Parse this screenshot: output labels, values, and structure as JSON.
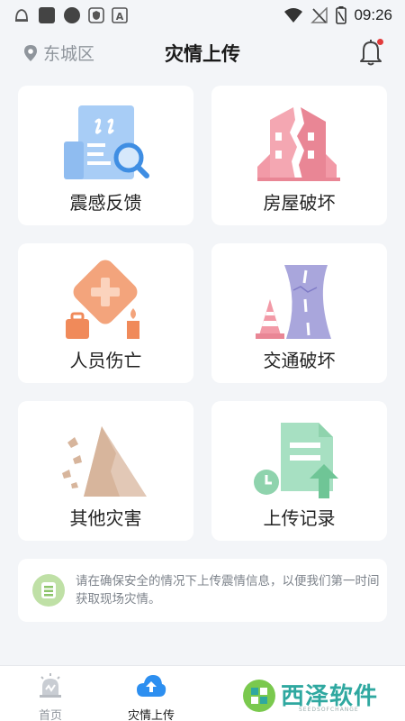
{
  "status_bar": {
    "time": "09:26",
    "left_icons": [
      "notification-icon",
      "app-square-icon",
      "app-circle-icon",
      "shield-icon",
      "font-a-icon"
    ],
    "right_icons": [
      "wifi-icon",
      "no-signal-icon",
      "battery-icon"
    ]
  },
  "header": {
    "location": "东城区",
    "title": "灾情上传",
    "has_notification": true
  },
  "cards": [
    {
      "label": "震感反馈",
      "icon": "seismic-report-icon",
      "color": "#8fbcf0"
    },
    {
      "label": "房屋破坏",
      "icon": "building-damage-icon",
      "color": "#f29aa7"
    },
    {
      "label": "人员伤亡",
      "icon": "casualty-icon",
      "color": "#f3a47c"
    },
    {
      "label": "交通破坏",
      "icon": "road-damage-icon",
      "color": "#a9a6dc"
    },
    {
      "label": "其他灾害",
      "icon": "landslide-icon",
      "color": "#d9b9a2"
    },
    {
      "label": "上传记录",
      "icon": "upload-record-icon",
      "color": "#8fd3ad"
    }
  ],
  "notice": {
    "text": "请在确保安全的情况下上传震情信息，以便我们第一时间获取现场灾情。",
    "icon": "notice-icon"
  },
  "tabs": [
    {
      "label": "首页",
      "icon": "home-alarm-icon"
    },
    {
      "label": "灾情上传",
      "icon": "upload-cloud-icon",
      "active": true
    }
  ],
  "watermark": {
    "text": "西泽软件",
    "subtext": "SEEDSOFCHANGE"
  },
  "colors": {
    "background": "#f3f5f8",
    "active_tab": "#2d8ff0",
    "badge": "#e23c3c"
  }
}
